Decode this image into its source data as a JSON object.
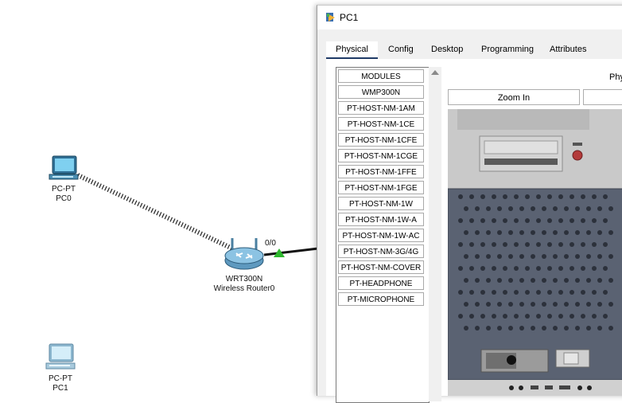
{
  "workspace": {
    "devices": [
      {
        "type": "PC-PT",
        "name": "PC0"
      },
      {
        "type": "WRT300N",
        "name": "Wireless Router0"
      },
      {
        "type": "PC-PT",
        "name": "PC1"
      }
    ],
    "port_label": "0/0"
  },
  "window": {
    "title": "PC1",
    "tabs": [
      "Physical",
      "Config",
      "Desktop",
      "Programming",
      "Attributes"
    ],
    "active_tab": "Physical",
    "physical": {
      "heading": "Phy",
      "zoom_in_label": "Zoom In",
      "modules": [
        "MODULES",
        "WMP300N",
        "PT-HOST-NM-1AM",
        "PT-HOST-NM-1CE",
        "PT-HOST-NM-1CFE",
        "PT-HOST-NM-1CGE",
        "PT-HOST-NM-1FFE",
        "PT-HOST-NM-1FGE",
        "PT-HOST-NM-1W",
        "PT-HOST-NM-1W-A",
        "PT-HOST-NM-1W-AC",
        "PT-HOST-NM-3G/4G",
        "PT-HOST-NM-COVER",
        "PT-HEADPHONE",
        "PT-MICROPHONE"
      ]
    }
  },
  "colors": {
    "link_green": "#2eb82e",
    "tab_underline": "#1f3a66",
    "tower_panel": "#5a6272"
  }
}
